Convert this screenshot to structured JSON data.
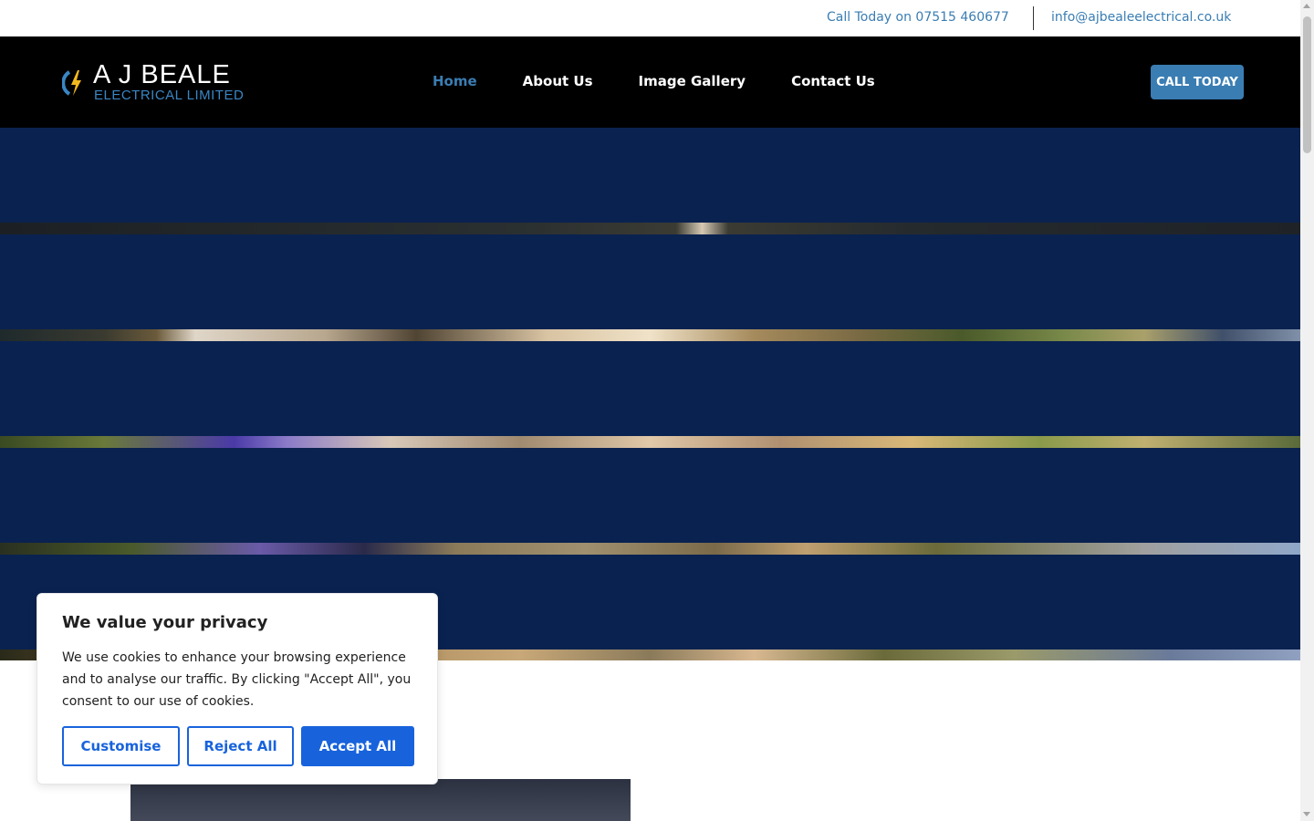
{
  "topbar": {
    "phone_text": "Call Today on 07515 460677",
    "email_text": "info@ajbealeelectrical.co.uk"
  },
  "header": {
    "logo": {
      "name": "A J BEALE",
      "subtitle": "ELECTRICAL LIMITED",
      "icon": "lightning-bolt-icon"
    },
    "nav": [
      {
        "label": "Home",
        "active": true
      },
      {
        "label": "About Us",
        "active": false
      },
      {
        "label": "Image Gallery",
        "active": false
      },
      {
        "label": "Contact Us",
        "active": false
      }
    ],
    "cta_label": "CALL TODAY"
  },
  "cookie_banner": {
    "title": "We value your privacy",
    "body": "We use cookies to enhance your browsing experience and to analyse our traffic. By clicking \"Accept All\", you consent to our use of cookies.",
    "customise_label": "Customise",
    "reject_label": "Reject All",
    "accept_label": "Accept All"
  },
  "colors": {
    "accent": "#3a7db3",
    "hero_overlay": "#0a2250",
    "cookie_primary": "#1863dc",
    "header_bg": "#000000"
  }
}
